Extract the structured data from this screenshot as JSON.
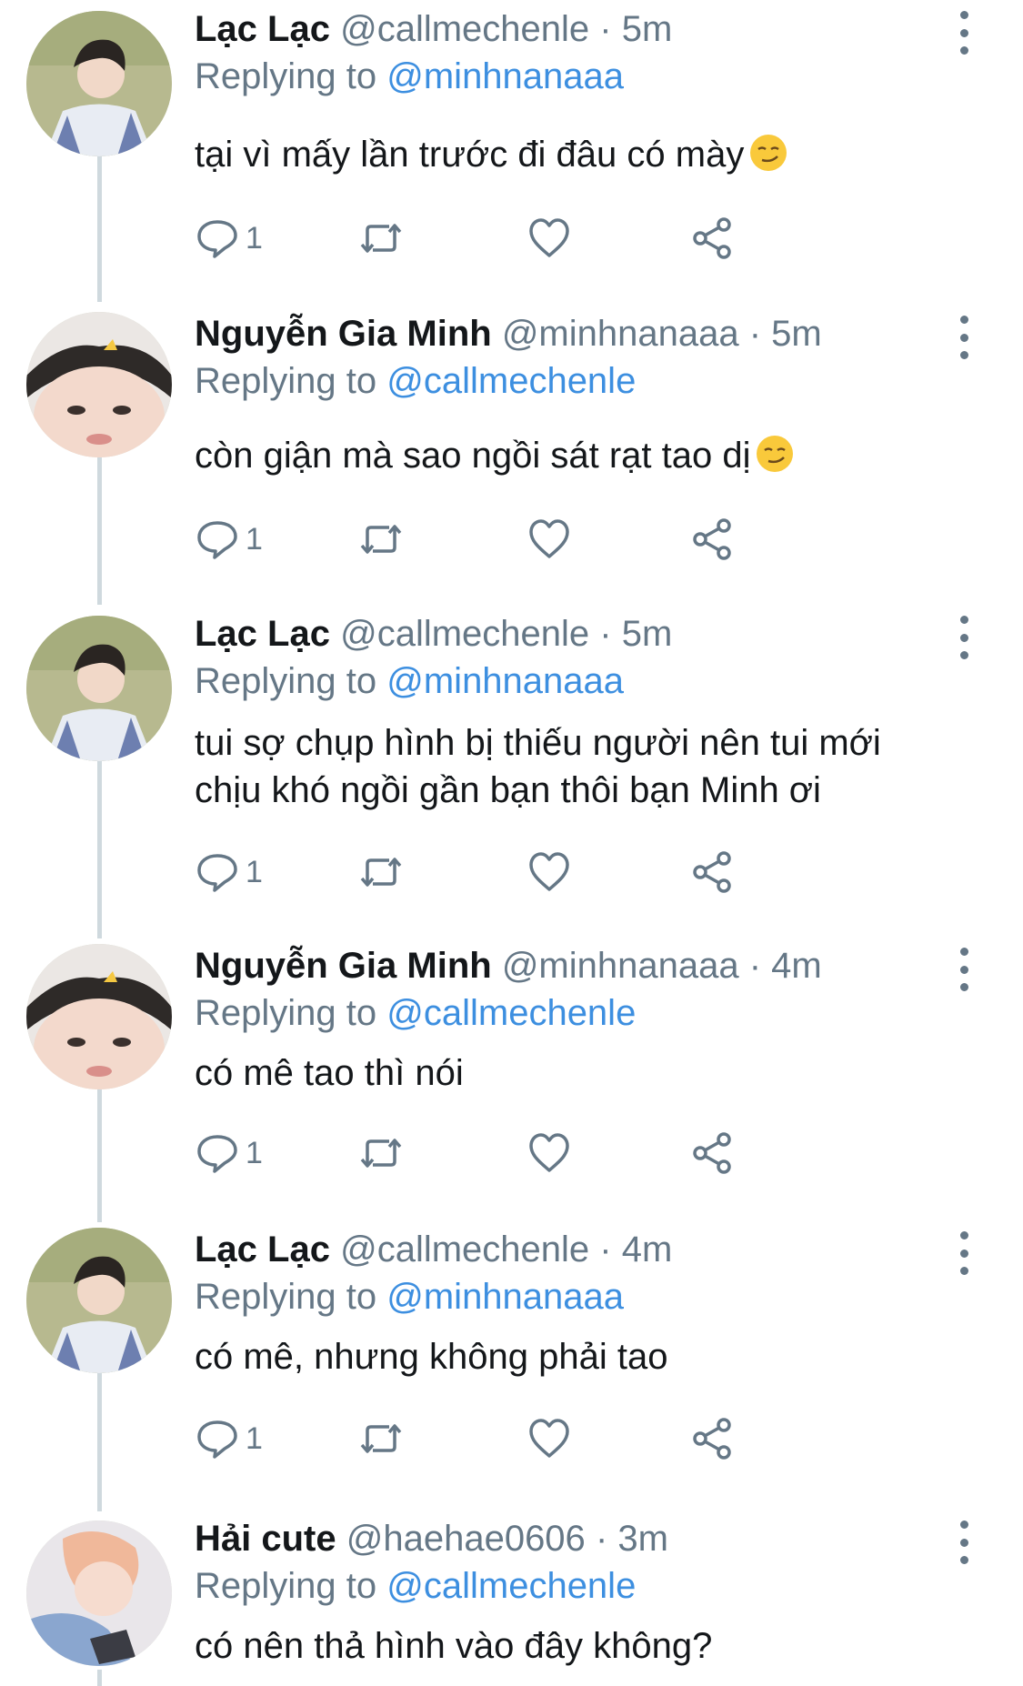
{
  "colors": {
    "link": "#3d8fe0",
    "meta": "#657786",
    "text": "#14171a",
    "connector": "#cfd9de"
  },
  "tweets": [
    {
      "name": "Lạc Lạc",
      "handle": "@callmechenle",
      "time": "· 5m",
      "replying_prefix": "Replying to",
      "replying_to": "@minhnanaaa",
      "text": "tại vì mấy lần trước đi đâu có mày",
      "emoji": "smirking-face",
      "reply_count": "1",
      "avatar": "avatar-lac-lac"
    },
    {
      "name": "Nguyễn Gia Minh",
      "handle": "@minhnanaaa",
      "time": "· 5m",
      "replying_prefix": "Replying to",
      "replying_to": "@callmechenle",
      "text": "còn giận mà sao ngồi sát rạt tao dị",
      "emoji": "smirking-face",
      "reply_count": "1",
      "avatar": "avatar-minh"
    },
    {
      "name": "Lạc Lạc",
      "handle": "@callmechenle",
      "time": "· 5m",
      "replying_prefix": "Replying to",
      "replying_to": "@minhnanaaa",
      "text_line1": "tui sợ chụp hình bị thiếu người nên tui mới",
      "text_line2": "chịu khó ngồi gần bạn thôi bạn Minh ơi",
      "reply_count": "1",
      "avatar": "avatar-lac-lac"
    },
    {
      "name": "Nguyễn Gia Minh",
      "handle": "@minhnanaaa",
      "time": "· 4m",
      "replying_prefix": "Replying to",
      "replying_to": "@callmechenle",
      "text": "có mê tao thì nói",
      "reply_count": "1",
      "avatar": "avatar-minh"
    },
    {
      "name": "Lạc Lạc",
      "handle": "@callmechenle",
      "time": "· 4m",
      "replying_prefix": "Replying to",
      "replying_to": "@minhnanaaa",
      "text": "có mê, nhưng không phải tao",
      "reply_count": "1",
      "avatar": "avatar-lac-lac"
    },
    {
      "name": "Hải cute",
      "handle": "@haehae0606",
      "time": "· 3m",
      "replying_prefix": "Replying to",
      "replying_to": "@callmechenle",
      "text": "có nên thả hình vào đây không?",
      "avatar": "avatar-hai"
    }
  ]
}
